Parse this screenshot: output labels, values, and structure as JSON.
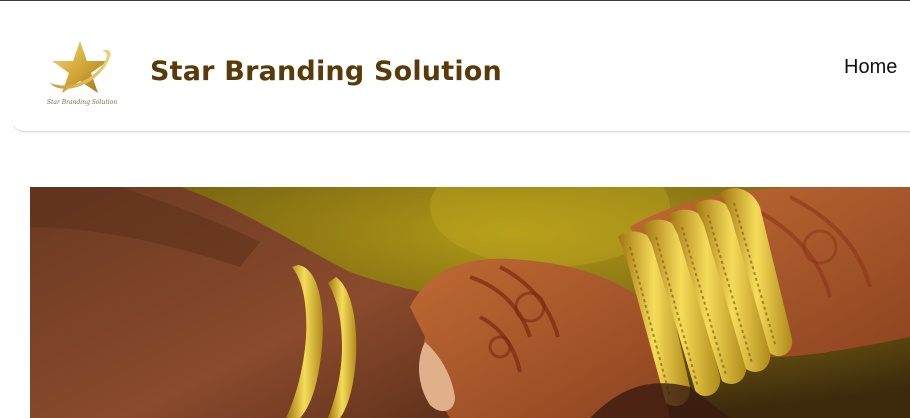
{
  "header": {
    "brand_name": "Star Branding Solution",
    "logo_tagline": "Star Branding Solution",
    "logo_icon": "gold-star-swoosh"
  },
  "nav": {
    "items": [
      {
        "label": "Home"
      }
    ]
  },
  "hero": {
    "image": "wedding-hands-gold-bangles-henna"
  },
  "colors": {
    "brand_text": "#5a3a08",
    "gold": "#d4a838",
    "hero_background": "#6f5a10"
  }
}
